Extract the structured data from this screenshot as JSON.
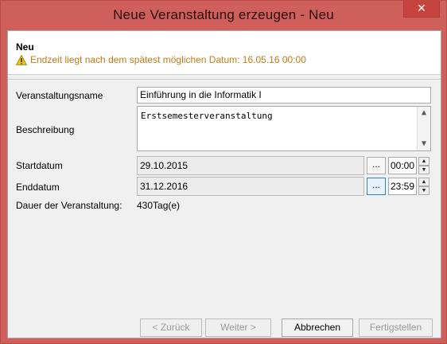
{
  "window": {
    "title": "Neue Veranstaltung erzeugen - Neu",
    "close_label": "✕"
  },
  "header": {
    "title": "Neu",
    "message": "Endzeit liegt nach dem spätest möglichen Datum: 16.05.16 00:00"
  },
  "form": {
    "name_label": "Veranstaltungsname",
    "name_value": "Einführung in die Informatik I",
    "description_label": "Beschreibung",
    "description_value": "Erstsemesterveranstaltung",
    "start_label": "Startdatum",
    "start_date": "29.10.2015",
    "start_time": "00:00",
    "end_label": "Enddatum",
    "end_date": "31.12.2016",
    "end_time": "23:59",
    "browse_label": "...",
    "duration_label": "Dauer der Veranstaltung:",
    "duration_value": "430Tag(e)"
  },
  "buttons": {
    "back": "< Zurück",
    "next": "Weiter >",
    "cancel": "Abbrechen",
    "finish": "Fertigstellen"
  },
  "colors": {
    "frame": "#cf5f5a",
    "warning_text": "#c57a16"
  }
}
